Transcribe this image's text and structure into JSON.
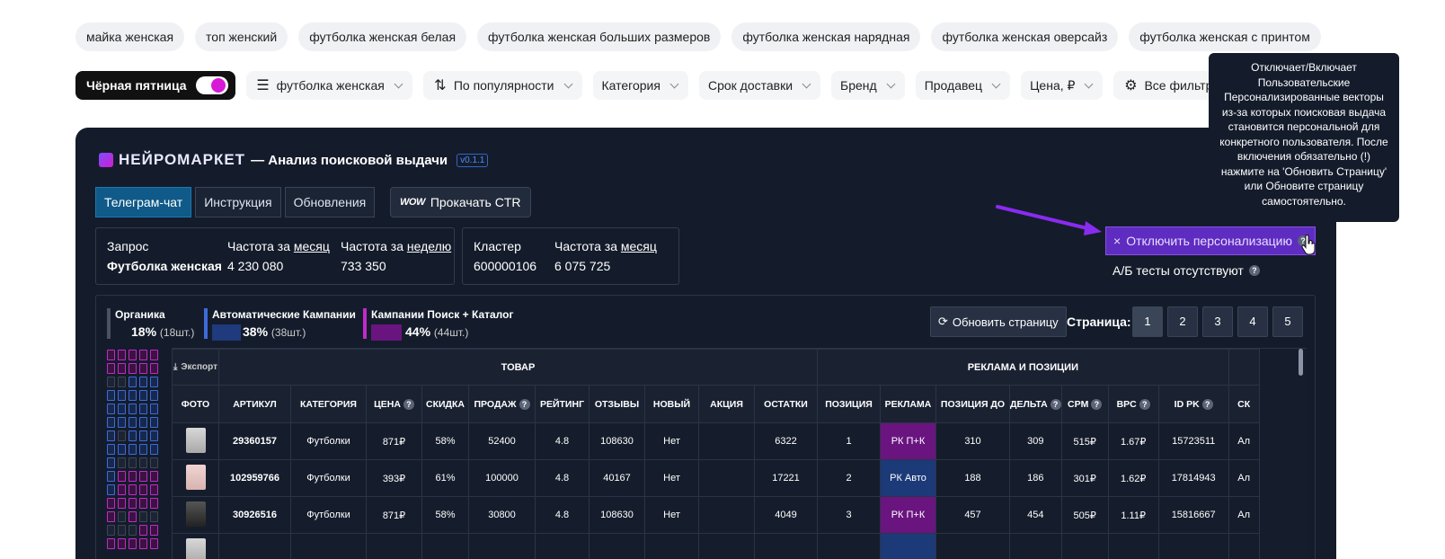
{
  "chips": [
    "майка женская",
    "топ женский",
    "футболка женская белая",
    "футболка женская больших размеров",
    "футболка женская нарядная",
    "футболка женская оверсайз",
    "футболка женская с принтом"
  ],
  "filters": {
    "black_friday": "Чёрная пятница",
    "query": "футболка женская",
    "sort": "По популярности",
    "category": "Категория",
    "delivery": "Срок доставки",
    "brand": "Бренд",
    "seller": "Продавец",
    "price": "Цена, ₽",
    "all_filters": "Все фильтры"
  },
  "tooltip": "Отключает/Включает Пользовательские Персонализированные векторы из-за которых поисковая выдача становится персональной для конкретного пользователя. После включения обязательно (!) нажмите на 'Обновить Страницу' или Обновите страницу самостоятельно.",
  "panel": {
    "logo": "НЕЙРОМАРКЕТ",
    "subtitle": "— Анализ поисковой выдачи",
    "version": "v0.1.1",
    "nav": [
      "Телеграм-чат",
      "Инструкция",
      "Обновления"
    ],
    "ctr_logo": "WOW",
    "ctr_label": "Прокачать CTR",
    "stats1": {
      "query_label": "Запрос",
      "query_value": "Футболка женская",
      "freq_month_label": "Частота за",
      "freq_month_link": "месяц",
      "freq_month_value": "4 230 080",
      "freq_week_label": "Частота за",
      "freq_week_link": "неделю",
      "freq_week_value": "733 350"
    },
    "stats2": {
      "cluster_label": "Кластер",
      "cluster_value": "600000106",
      "freq_month_label": "Частота за",
      "freq_month_link": "месяц",
      "freq_month_value": "6 075 725"
    },
    "disable_personalization": "Отключить персонализацию",
    "ab_tests": "А/Б тесты отсутствуют",
    "legend": [
      {
        "title": "Органика",
        "pct": "18%",
        "count": "(18шт.)",
        "value": 18,
        "color": "#4a5263"
      },
      {
        "title": "Автоматические Кампании",
        "pct": "38%",
        "count": "(38шт.)",
        "value": 38,
        "color": "#3d6bd9"
      },
      {
        "title": "Кампании Поиск + Каталог",
        "pct": "44%",
        "count": "(44шт.)",
        "value": 44,
        "color": "#c22ac8"
      }
    ],
    "refresh": "Обновить страницу",
    "page_label": "Страница:",
    "pages": [
      "1",
      "2",
      "3",
      "4",
      "5"
    ],
    "table": {
      "export": "Экспорт",
      "group_product": "ТОВАР",
      "group_ads": "РЕКЛАМА И ПОЗИЦИИ",
      "columns": [
        "ФОТО",
        "АРТИКУЛ",
        "КАТЕГОРИЯ",
        "ЦЕНА",
        "СКИДКА",
        "ПРОДАЖ",
        "РЕЙТИНГ",
        "ОТЗЫВЫ",
        "НОВЫЙ",
        "АКЦИЯ",
        "ОСТАТКИ",
        "ПОЗИЦИЯ",
        "РЕКЛАМА",
        "ПОЗИЦИЯ ДО",
        "ДЕЛЬТА",
        "CPM",
        "BPC",
        "ID PK",
        "СК"
      ],
      "rows": [
        {
          "article": "29360157",
          "category": "Футболки",
          "price": "871₽",
          "discount": "58%",
          "sales": "52400",
          "rating": "4.8",
          "reviews": "108630",
          "new": "Нет",
          "promo": "",
          "stock": "6322",
          "position": "1",
          "ad": "РК П+К",
          "ad_type": "pk",
          "pos_before": "310",
          "delta": "309",
          "cpm": "515₽",
          "bpc": "1.67₽",
          "id_pk": "15723511",
          "sk": "Ал"
        },
        {
          "article": "102959766",
          "category": "Футболки",
          "price": "393₽",
          "discount": "61%",
          "sales": "100000",
          "rating": "4.8",
          "reviews": "40167",
          "new": "Нет",
          "promo": "",
          "stock": "17221",
          "position": "2",
          "ad": "РК Авто",
          "ad_type": "auto",
          "pos_before": "188",
          "delta": "186",
          "cpm": "301₽",
          "bpc": "1.62₽",
          "id_pk": "17814943",
          "sk": "Ал"
        },
        {
          "article": "30926516",
          "category": "Футболки",
          "price": "871₽",
          "discount": "58%",
          "sales": "30800",
          "rating": "4.8",
          "reviews": "108630",
          "new": "Нет",
          "promo": "",
          "stock": "4049",
          "position": "3",
          "ad": "РК П+К",
          "ad_type": "pk",
          "pos_before": "457",
          "delta": "454",
          "cpm": "505₽",
          "bpc": "1.11₽",
          "id_pk": "15816667",
          "sk": "Ал"
        }
      ]
    }
  }
}
